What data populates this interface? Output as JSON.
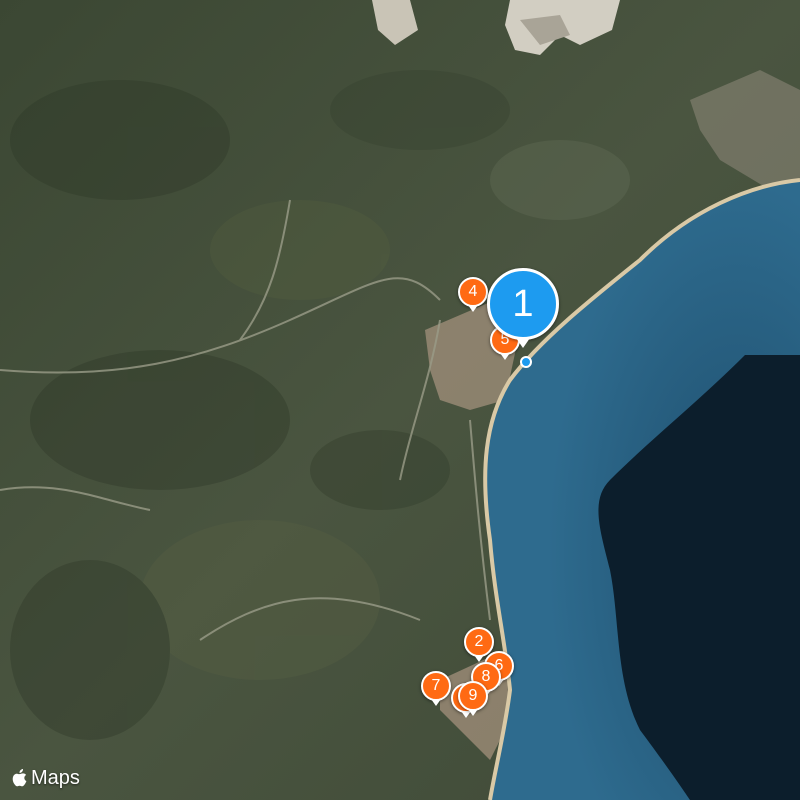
{
  "attribution": {
    "label": "Maps"
  },
  "pins": [
    {
      "id": "1",
      "label": "1",
      "kind": "selected"
    },
    {
      "id": "2",
      "label": "2",
      "kind": "poi"
    },
    {
      "id": "4",
      "label": "4",
      "kind": "poi"
    },
    {
      "id": "5",
      "label": "5",
      "kind": "poi"
    },
    {
      "id": "6",
      "label": "6",
      "kind": "poi"
    },
    {
      "id": "7",
      "label": "7",
      "kind": "poi"
    },
    {
      "id": "8",
      "label": "8",
      "kind": "poi"
    },
    {
      "id": "9",
      "label": "9",
      "kind": "poi"
    }
  ],
  "colors": {
    "selected_pin": "#1D9BF0",
    "poi_pin": "#FF6A13",
    "land": "#3E4A36",
    "shallow_sea": "#2E6688",
    "deep_sea": "#0C1E2C",
    "beach": "#D9C9A6"
  }
}
